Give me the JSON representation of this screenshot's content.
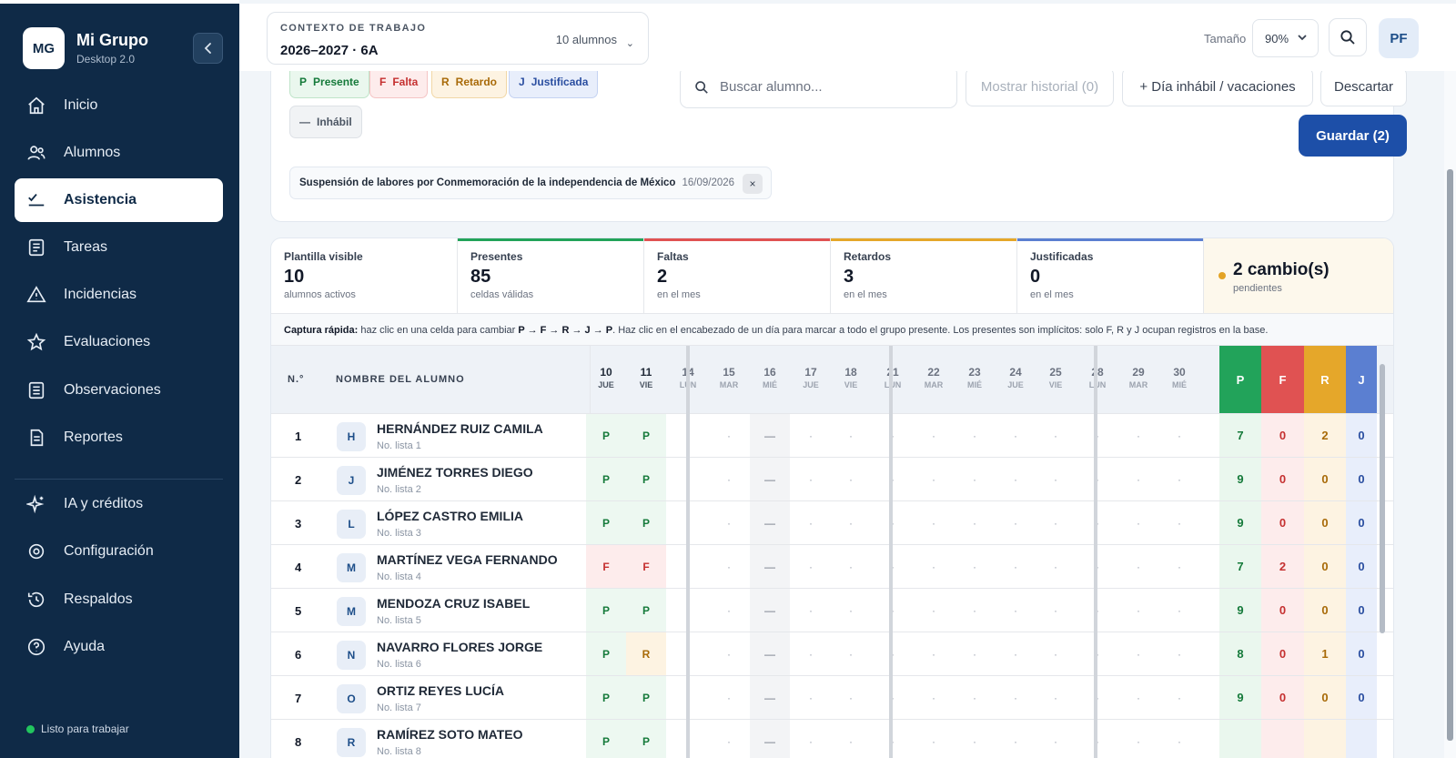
{
  "brand": {
    "logo": "MG",
    "name": "Mi Grupo",
    "version": "Desktop 2.0"
  },
  "nav": {
    "items": [
      {
        "label": "Inicio",
        "icon": "home-icon"
      },
      {
        "label": "Alumnos",
        "icon": "users-icon"
      },
      {
        "label": "Asistencia",
        "icon": "checklist-icon",
        "active": true
      },
      {
        "label": "Tareas",
        "icon": "document-icon"
      },
      {
        "label": "Incidencias",
        "icon": "warning-icon"
      },
      {
        "label": "Evaluaciones",
        "icon": "star-icon"
      },
      {
        "label": "Observaciones",
        "icon": "notes-icon"
      },
      {
        "label": "Reportes",
        "icon": "report-icon"
      },
      {
        "label": "IA y créditos",
        "icon": "sparkle-icon"
      },
      {
        "label": "Configuración",
        "icon": "gear-icon"
      },
      {
        "label": "Respaldos",
        "icon": "history-icon"
      },
      {
        "label": "Ayuda",
        "icon": "help-icon"
      }
    ],
    "status": "Listo para trabajar"
  },
  "header": {
    "context_label": "CONTEXTO DE TRABAJO",
    "context_value": "2026–2027 · 6A",
    "student_count": "10 alumnos",
    "size_label": "Tamaño",
    "size_value": "90%",
    "user_initials": "PF"
  },
  "legend": {
    "presente": {
      "code": "P",
      "label": "Presente"
    },
    "falta": {
      "code": "F",
      "label": "Falta"
    },
    "retardo": {
      "code": "R",
      "label": "Retardo"
    },
    "justificada": {
      "code": "J",
      "label": "Justificada"
    },
    "inhabil": {
      "code": "—",
      "label": "Inhábil"
    }
  },
  "toolbar": {
    "search_placeholder": "Buscar alumno...",
    "history_label": "Mostrar historial (0)",
    "holiday_label": "+ Día inhábil / vacaciones",
    "discard_label": "Descartar",
    "save_label": "Guardar (2)"
  },
  "holiday": {
    "name": "Suspensión de labores por Conmemoración de la independencia de México",
    "date": "16/09/2026",
    "remove": "×"
  },
  "stats": {
    "visible": {
      "label": "Plantilla visible",
      "value": "10",
      "sub": "alumnos activos"
    },
    "presentes": {
      "label": "Presentes",
      "value": "85",
      "sub": "celdas válidas"
    },
    "faltas": {
      "label": "Faltas",
      "value": "2",
      "sub": "en el mes"
    },
    "retardos": {
      "label": "Retardos",
      "value": "3",
      "sub": "en el mes"
    },
    "justificadas": {
      "label": "Justificadas",
      "value": "0",
      "sub": "en el mes"
    },
    "pending": {
      "value": "2 cambio(s)",
      "sub": "pendientes"
    }
  },
  "tip": {
    "bold": "Captura rápida:",
    "text1": " haz clic en una celda para cambiar ",
    "seq": "P → F → R → J → P",
    "text2": ". Haz clic en el encabezado de un día para marcar a todo el grupo presente. Los presentes son implícitos: solo F, R y J ocupan registros en la base."
  },
  "grid": {
    "col_no": "N.°",
    "col_name": "NOMBRE DEL ALUMNO",
    "days": [
      {
        "n": "10",
        "w": "JUE"
      },
      {
        "n": "11",
        "w": "VIE"
      },
      {
        "n": "14",
        "w": "LUN"
      },
      {
        "n": "15",
        "w": "MAR"
      },
      {
        "n": "16",
        "w": "MIÉ"
      },
      {
        "n": "17",
        "w": "JUE"
      },
      {
        "n": "18",
        "w": "VIE"
      },
      {
        "n": "21",
        "w": "LUN"
      },
      {
        "n": "22",
        "w": "MAR"
      },
      {
        "n": "23",
        "w": "MIÉ"
      },
      {
        "n": "24",
        "w": "JUE"
      },
      {
        "n": "25",
        "w": "VIE"
      },
      {
        "n": "28",
        "w": "LUN"
      },
      {
        "n": "29",
        "w": "MAR"
      },
      {
        "n": "30",
        "w": "MIÉ"
      }
    ],
    "summary_cols": [
      "P",
      "F",
      "R",
      "J"
    ],
    "students": [
      {
        "no": "1",
        "initial": "H",
        "name": "HERNÁNDEZ RUIZ CAMILA",
        "sub": "No. lista 1",
        "d1": "P",
        "d2": "P",
        "p": "7",
        "f": "0",
        "r": "2",
        "j": "0"
      },
      {
        "no": "2",
        "initial": "J",
        "name": "JIMÉNEZ TORRES DIEGO",
        "sub": "No. lista 2",
        "d1": "P",
        "d2": "P",
        "p": "9",
        "f": "0",
        "r": "0",
        "j": "0"
      },
      {
        "no": "3",
        "initial": "L",
        "name": "LÓPEZ CASTRO EMILIA",
        "sub": "No. lista 3",
        "d1": "P",
        "d2": "P",
        "p": "9",
        "f": "0",
        "r": "0",
        "j": "0"
      },
      {
        "no": "4",
        "initial": "M",
        "name": "MARTÍNEZ VEGA FERNANDO",
        "sub": "No. lista 4",
        "d1": "F",
        "d2": "F",
        "p": "7",
        "f": "2",
        "r": "0",
        "j": "0"
      },
      {
        "no": "5",
        "initial": "M",
        "name": "MENDOZA CRUZ ISABEL",
        "sub": "No. lista 5",
        "d1": "P",
        "d2": "P",
        "p": "9",
        "f": "0",
        "r": "0",
        "j": "0"
      },
      {
        "no": "6",
        "initial": "N",
        "name": "NAVARRO FLORES JORGE",
        "sub": "No. lista 6",
        "d1": "P",
        "d2": "R",
        "p": "8",
        "f": "0",
        "r": "1",
        "j": "0"
      },
      {
        "no": "7",
        "initial": "O",
        "name": "ORTIZ REYES LUCÍA",
        "sub": "No. lista 7",
        "d1": "P",
        "d2": "P",
        "p": "9",
        "f": "0",
        "r": "0",
        "j": "0"
      },
      {
        "no": "8",
        "initial": "R",
        "name": "RAMÍREZ SOTO MATEO",
        "sub": "No. lista 8",
        "d1": "P",
        "d2": "P",
        "p": "",
        "f": "",
        "r": "",
        "j": ""
      }
    ],
    "empty_mark": "·",
    "inhabil_mark": "—"
  },
  "colors": {
    "sidebar": "#0f2a47",
    "accent": "#1d4fa8",
    "present": "#22a35a",
    "absent": "#e05252",
    "late": "#e5a72a",
    "justified": "#5b7fd1"
  }
}
